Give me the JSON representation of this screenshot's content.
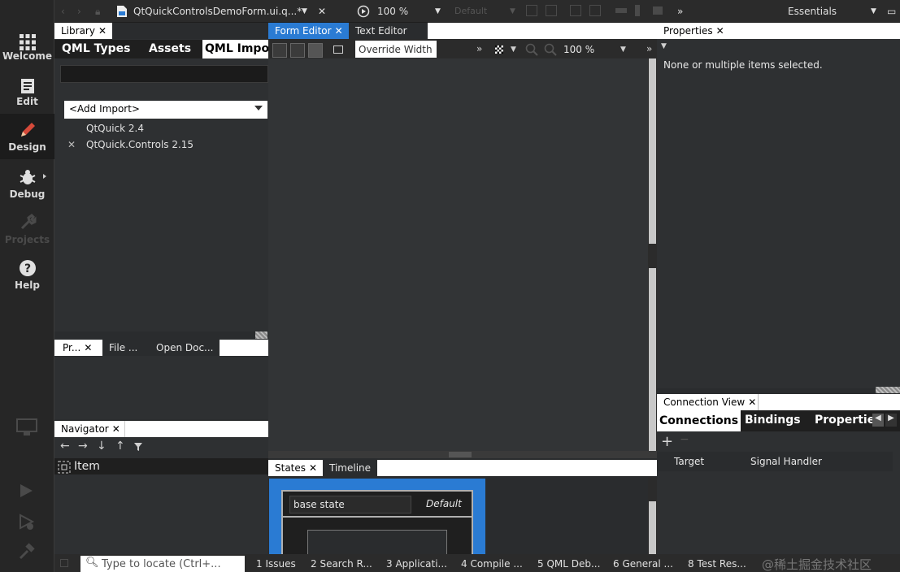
{
  "modes": [
    {
      "label": "Welcome",
      "icon": "grid-icon"
    },
    {
      "label": "Edit",
      "icon": "edit-document-icon"
    },
    {
      "label": "Design",
      "icon": "pencil-icon"
    },
    {
      "label": "Debug",
      "icon": "bug-icon"
    },
    {
      "label": "Projects",
      "icon": "wrench-icon"
    },
    {
      "label": "Help",
      "icon": "help-icon"
    }
  ],
  "toolbar": {
    "file_name": "QtQuickControlsDemoForm.ui.q...*",
    "zoom": "100 %",
    "style": "Default",
    "workspace": "Essentials"
  },
  "library": {
    "tab_label": "Library",
    "tabs": [
      "QML Types",
      "Assets",
      "QML Imports"
    ],
    "add_import": "<Add Import>",
    "imports": [
      "QtQuick 2.4",
      "QtQuick.Controls 2.15"
    ]
  },
  "projects_tabs": [
    "Pr...",
    "File ...",
    "Open Doc..."
  ],
  "navigator": {
    "tab_label": "Navigator",
    "item": "Item"
  },
  "editor": {
    "tabs": [
      "Form Editor",
      "Text Editor"
    ],
    "override_width": "Override Width",
    "zoom": "100 %"
  },
  "properties": {
    "tab_label": "Properties",
    "message": "None or multiple items selected."
  },
  "connection_view": {
    "tab_label": "Connection View",
    "tabs": [
      "Connections",
      "Bindings",
      "Properties"
    ],
    "columns": [
      "Target",
      "Signal Handler"
    ]
  },
  "states": {
    "tabs": [
      "States",
      "Timeline"
    ],
    "base_state": "base state",
    "default_label": "Default"
  },
  "bottom": {
    "locator": "Type to locate (Ctrl+...",
    "panes": [
      "1  Issues",
      "2  Search R...",
      "3  Applicati...",
      "4  Compile ...",
      "5  QML Deb...",
      "6  General ...",
      "8  Test Res..."
    ]
  },
  "watermark": "@稀土掘金技术社区"
}
